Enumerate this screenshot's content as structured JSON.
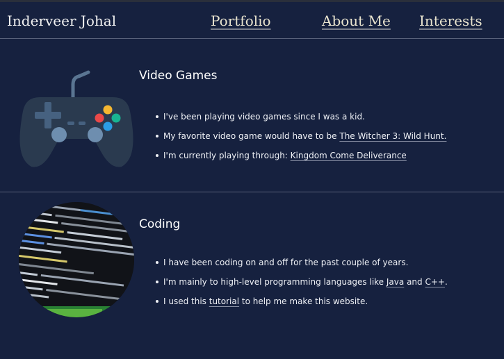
{
  "header": {
    "brand": "Inderveer Johal",
    "nav": [
      "Portfolio",
      "About Me",
      "Interests"
    ]
  },
  "sections": [
    {
      "title": "Video Games",
      "icon": "gamepad-icon",
      "items": [
        {
          "text": "I've been playing video games since I was a kid."
        },
        {
          "prefix": "My favorite video game would have to be ",
          "link": "The Witcher 3: Wild Hunt."
        },
        {
          "prefix": "I'm currently playing through: ",
          "link": "Kingdom Come Deliverance"
        }
      ]
    },
    {
      "title": "Coding",
      "image": "code-screenshot",
      "items": [
        {
          "text": "I have been coding on and off for the past couple of years."
        },
        {
          "prefix": "I'm mainly to high-level programming languages like ",
          "link1": "Java",
          "mid": " and ",
          "link2": "C++",
          "suffix": "."
        },
        {
          "prefix": "I used this ",
          "link": "tutorial",
          "suffix": " to help me make this website."
        }
      ]
    }
  ],
  "colors": {
    "background": "#16213f",
    "controller_body": "#2a3a4f",
    "button_yellow": "#f5b731",
    "button_red": "#ea4949",
    "button_green": "#19b392",
    "button_blue": "#2b9de6"
  }
}
